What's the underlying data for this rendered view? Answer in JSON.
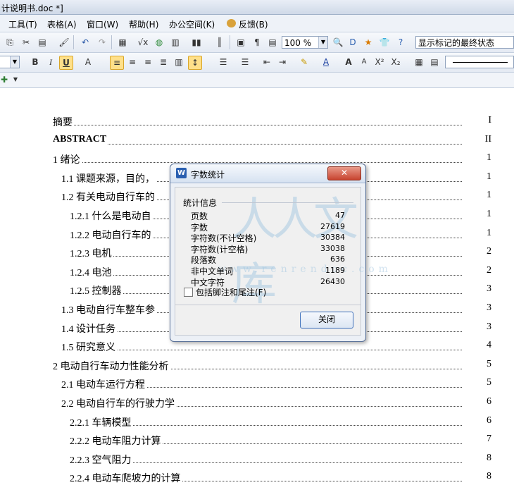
{
  "window": {
    "title": "计说明书.doc *]"
  },
  "menu": {
    "items": [
      "工具(T)",
      "表格(A)",
      "窗口(W)",
      "帮助(H)",
      "办公空间(K)",
      "反馈(B)"
    ]
  },
  "toolbar": {
    "zoom": "100 %",
    "display_mode": "显示标记的最终状态"
  },
  "document": {
    "toc": [
      {
        "label": "摘要",
        "page": "I"
      },
      {
        "label": "ABSTRACT",
        "page": "II"
      },
      {
        "label": "1   绪论",
        "page": "1"
      },
      {
        "label": "1.1 课题来源，目的，",
        "page": "1"
      },
      {
        "label": "1.2 有关电动自行车的",
        "page": "1"
      },
      {
        "label": "1.2.1 什么是电动自",
        "page": "1"
      },
      {
        "label": "1.2.2 电动自行车的",
        "page": "1"
      },
      {
        "label": "1.2.3 电机",
        "page": "2"
      },
      {
        "label": "1.2.4 电池",
        "page": "2"
      },
      {
        "label": "1.2.5 控制器",
        "page": "3"
      },
      {
        "label": "1.3 电动自行车整车参",
        "page": "3"
      },
      {
        "label": "1.4 设计任务",
        "page": "3"
      },
      {
        "label": "1.5 研究意义",
        "page": "4"
      },
      {
        "label": "2 电动自行车动力性能分析",
        "page": "5"
      },
      {
        "label": "2.1 电动车运行方程",
        "page": "5"
      },
      {
        "label": "2.2 电动自行车的行驶力学",
        "page": "6"
      },
      {
        "label": "2.2.1 车辆模型",
        "page": "6"
      },
      {
        "label": "2.2.2 电动车阻力计算",
        "page": "7"
      },
      {
        "label": "2.2.3 空气阻力",
        "page": "8"
      },
      {
        "label": "2.2.4 电动车爬坡力的计算",
        "page": "8"
      }
    ]
  },
  "dialog": {
    "title": "字数统计",
    "group_title": "统计信息",
    "stats": [
      {
        "label": "页数",
        "value": "47"
      },
      {
        "label": "字数",
        "value": "27619"
      },
      {
        "label": "字符数(不计空格)",
        "value": "30384"
      },
      {
        "label": "字符数(计空格)",
        "value": "33038"
      },
      {
        "label": "段落数",
        "value": "636"
      },
      {
        "label": "非中文单词",
        "value": "1189"
      },
      {
        "label": "中文字符",
        "value": "26430"
      }
    ],
    "checkbox_label": "包括脚注和尾注(F)",
    "close_label": "关闭",
    "watermark": "人人文库",
    "watermark_url": "www.renrendoc.com"
  }
}
